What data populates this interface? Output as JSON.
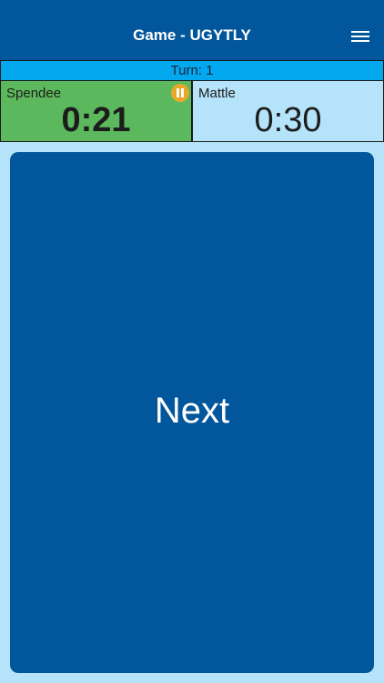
{
  "header": {
    "title": "Game - UGYTLY",
    "menu_icon": "hamburger-menu-icon"
  },
  "turn": {
    "label": "Turn: 1"
  },
  "players": [
    {
      "name": "Spendee",
      "time": "0:21",
      "active": true,
      "status_icon": "pause-icon"
    },
    {
      "name": "Mattle",
      "time": "0:30",
      "active": false
    }
  ],
  "main": {
    "button_label": "Next"
  },
  "colors": {
    "header_bg": "#02569b",
    "turn_bar": "#03a8ef",
    "active_player": "#5cb85c",
    "inactive_player": "#b5e4fa",
    "page_bg": "#b5e4fa",
    "button_bg": "#02569b",
    "pause_icon": "#e8a92a"
  }
}
